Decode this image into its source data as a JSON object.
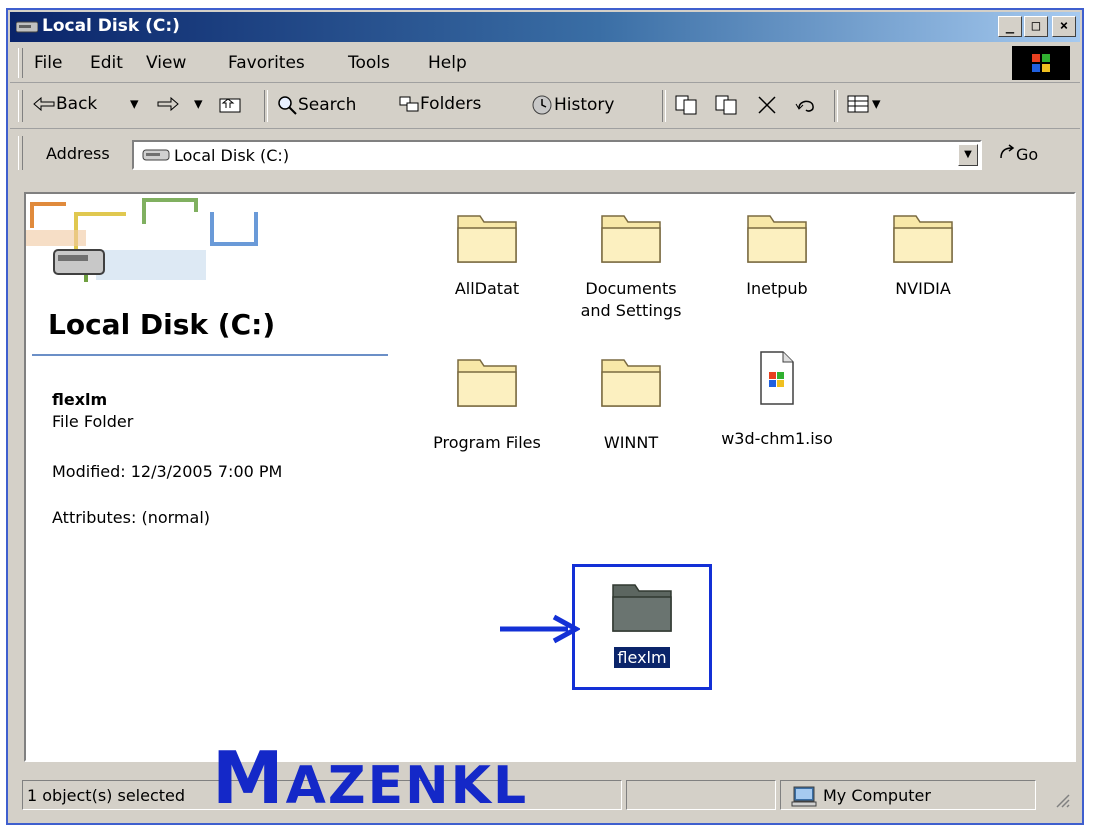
{
  "window": {
    "title": "Local Disk (C:)",
    "controls": {
      "minimize": "_",
      "maximize": "□",
      "close": "×"
    }
  },
  "menu": [
    "File",
    "Edit",
    "View",
    "Favorites",
    "Tools",
    "Help"
  ],
  "toolbar": {
    "back": "Back",
    "search": "Search",
    "folders": "Folders",
    "history": "History"
  },
  "address": {
    "label": "Address",
    "value": "Local Disk (C:)",
    "go": "Go"
  },
  "left_panel": {
    "heading": "Local Disk (C:)",
    "selected_name": "flexlm",
    "selected_type": "File Folder",
    "modified": "Modified: 12/3/2005 7:00 PM",
    "attributes": "Attributes: (normal)"
  },
  "items": [
    {
      "name": "AllDatat",
      "type": "folder"
    },
    {
      "name": "Documents and Settings",
      "type": "folder"
    },
    {
      "name": "Inetpub",
      "type": "folder"
    },
    {
      "name": "NVIDIA",
      "type": "folder"
    },
    {
      "name": "Program Files",
      "type": "folder"
    },
    {
      "name": "WINNT",
      "type": "folder"
    },
    {
      "name": "w3d-chm1.iso",
      "type": "file"
    },
    {
      "name": "flexlm",
      "type": "folder",
      "selected": true
    }
  ],
  "status": {
    "selection": "1 object(s) selected",
    "zone": "My Computer"
  },
  "watermark": "MAZENKL",
  "colors": {
    "title_start": "#0a246a",
    "title_end": "#a6caf0",
    "selection": "#0a246a",
    "highlight_box": "#1330d6",
    "watermark": "#1428c8"
  }
}
